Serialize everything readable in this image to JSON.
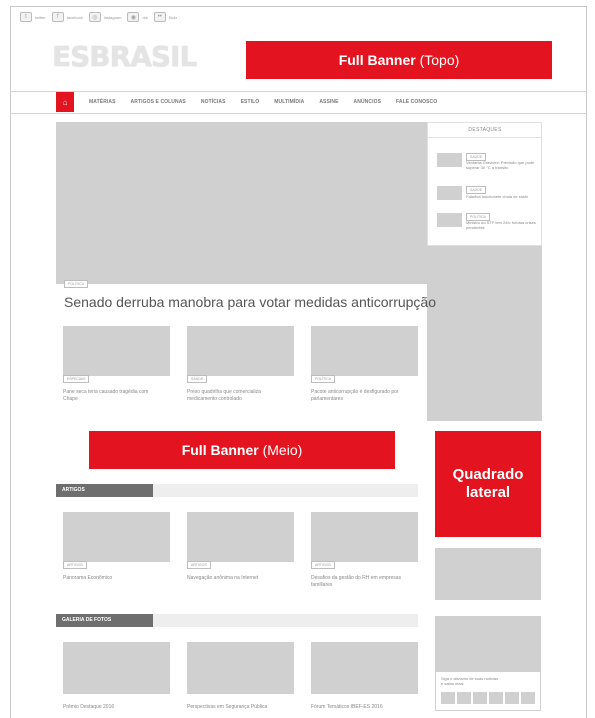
{
  "social": [
    {
      "icon": "twitter-icon",
      "label": "twitter"
    },
    {
      "icon": "facebook-icon",
      "label": "facebook"
    },
    {
      "icon": "instagram-icon",
      "label": "instagram"
    },
    {
      "icon": "rss-icon",
      "label": "rss"
    },
    {
      "icon": "flickr-icon",
      "label": "flickr"
    }
  ],
  "logo": "ESBRASIL",
  "banners": {
    "top": {
      "bold": "Full Banner",
      "light": " (Topo)"
    },
    "middle": {
      "bold": "Full Banner",
      "light": " (Meio)"
    },
    "square": {
      "line1": "Quadrado",
      "line2": "lateral"
    }
  },
  "nav": {
    "home_icon": "home-icon",
    "items": [
      "MATÉRIAS",
      "ARTIGOS E COLUNAS",
      "NOTÍCIAS",
      "ESTILO",
      "MULTIMÍDIA",
      "ASSINE",
      "ANÚNCIOS",
      "FALE CONOSCO"
    ]
  },
  "hero": {
    "tag": "POLÍTICA",
    "title": "Senado derruba manobra para votar medidas anticorrupção"
  },
  "hero_cards": [
    {
      "tag": "ESPECIAIS",
      "caption": "Pane seca teria causado tragédia com Chape"
    },
    {
      "tag": "SAÚDE",
      "caption": "Preso quadrilha que comercializa medicamento controlado"
    },
    {
      "tag": "POLÍTICA",
      "caption": "Pacote anticorrupção é desfigurado por parlamentares"
    }
  ],
  "sidebar": {
    "title": "DESTAQUES",
    "items": [
      {
        "tag": "SAÚDE",
        "text": "Ventania Gravidez: Previsão que pode superar 30 °C a trânsito"
      },
      {
        "tag": "SAÚDE",
        "text": "Falsifica lanchonete chula de sushi"
      },
      {
        "tag": "POLÍTICA",
        "text": "Ministro do STF tem 24h: futuras crises pendentes"
      }
    ]
  },
  "artigos": {
    "title": "ARTIGOS",
    "cards": [
      {
        "tag": "ARTIGOS",
        "caption": "Panorama Econômico"
      },
      {
        "tag": "ARTIGOS",
        "caption": "Navegação anônima na Internet"
      },
      {
        "tag": "ARTIGOS",
        "caption": "Desafios da gestão do RH em empresas familiares"
      }
    ]
  },
  "galeria": {
    "title": "GALERIA DE FOTOS",
    "cards": [
      {
        "caption": "Prêmio Destaque 2016"
      },
      {
        "caption": "Perspectivas em Segurança Pública"
      },
      {
        "caption": "Fórum Temáticos IBEF-ES 2016"
      }
    ]
  },
  "side_bottom_text": "Siga o ativismo de suas notícias e saiba mais"
}
